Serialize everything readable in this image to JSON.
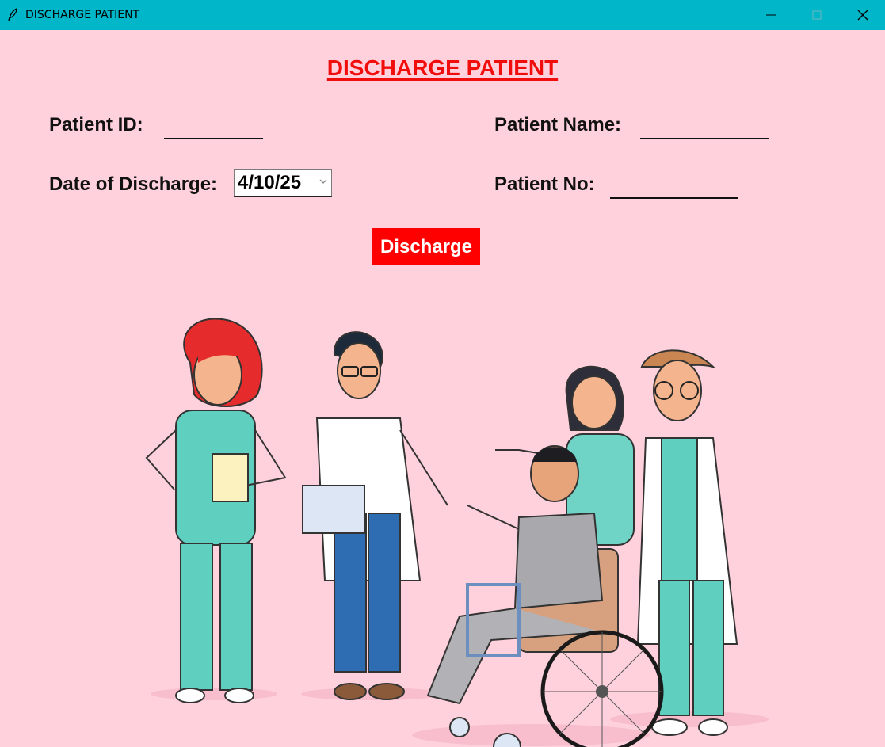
{
  "window": {
    "title": "DISCHARGE PATIENT",
    "icon": "feather-icon",
    "controls": [
      "minimize-icon",
      "maximize-icon",
      "close-icon"
    ]
  },
  "form": {
    "heading": "DISCHARGE PATIENT",
    "patient_id_label": "Patient ID:",
    "patient_id_value": "",
    "patient_name_label": "Patient Name:",
    "patient_name_value": "",
    "date_label": "Date of Discharge:",
    "date_value": "4/10/25",
    "patient_no_label": "Patient No:",
    "patient_no_value": "",
    "discharge_button": "Discharge"
  },
  "colors": {
    "titlebar": "#00b6c8",
    "background": "#ffd1dc",
    "heading": "#f20d0d",
    "button": "#ff0000",
    "scrubs": "#5fcfc0"
  }
}
